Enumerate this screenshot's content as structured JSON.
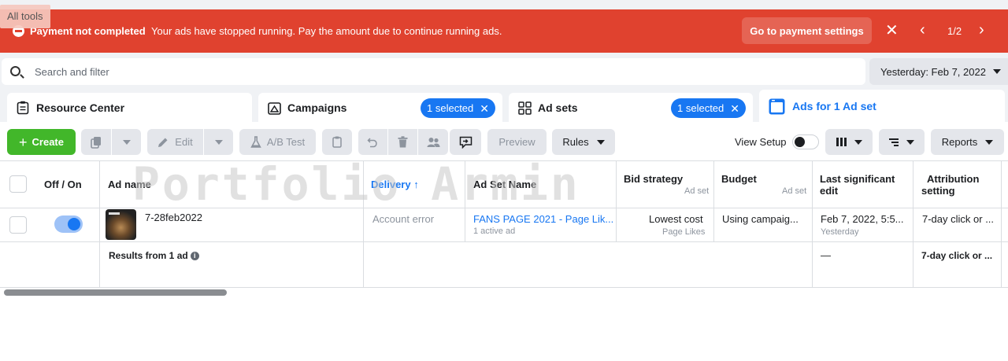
{
  "all_tools": "All tools",
  "banner": {
    "title": "Payment not completed",
    "message": "Your ads have stopped running. Pay the amount due to continue running ads.",
    "button": "Go to payment settings",
    "pager": "1/2"
  },
  "search": {
    "placeholder": "Search and filter"
  },
  "date_range": "Yesterday: Feb 7, 2022",
  "tabs": [
    {
      "label": "Resource Center",
      "icon": "clipboard-icon"
    },
    {
      "label": "Campaigns",
      "icon": "flag-icon",
      "selected": "1 selected"
    },
    {
      "label": "Ad sets",
      "icon": "grid-icon",
      "selected": "1 selected"
    },
    {
      "label": "Ads for 1 Ad set",
      "icon": "ad-window-icon",
      "active": true
    }
  ],
  "toolbar": {
    "create": "Create",
    "edit": "Edit",
    "ab_test": "A/B Test",
    "preview": "Preview",
    "rules": "Rules",
    "view_setup": "View Setup",
    "reports": "Reports"
  },
  "columns": {
    "off_on": "Off / On",
    "ad_name": "Ad name",
    "delivery": "Delivery",
    "ad_set_name": "Ad Set Name",
    "bid_strategy": "Bid strategy",
    "bid_strategy_sub": "Ad set",
    "budget": "Budget",
    "budget_sub": "Ad set",
    "last_edit_1": "Last significant",
    "last_edit_2": "edit",
    "attribution_1": "Attribution",
    "attribution_2": "setting"
  },
  "row": {
    "ad_name": "7-28feb2022",
    "delivery": "Account error",
    "ad_set_name": "FANS PAGE 2021 - Page Lik...",
    "ad_set_sub": "1 active ad",
    "bid_strategy": "Lowest cost",
    "bid_strategy_sub": "Page Likes",
    "budget": "Using campaig...",
    "last_edit": "Feb 7, 2022, 5:5...",
    "last_edit_sub": "Yesterday",
    "attribution": "7-day click or ..."
  },
  "summary": {
    "label": "Results from 1 ad",
    "last_edit": "—",
    "attribution": "7-day click or ..."
  },
  "watermark": "Portfolio Armin",
  "colors": {
    "banner": "#e0422f",
    "primary": "#1877f2",
    "create": "#42b72a"
  }
}
